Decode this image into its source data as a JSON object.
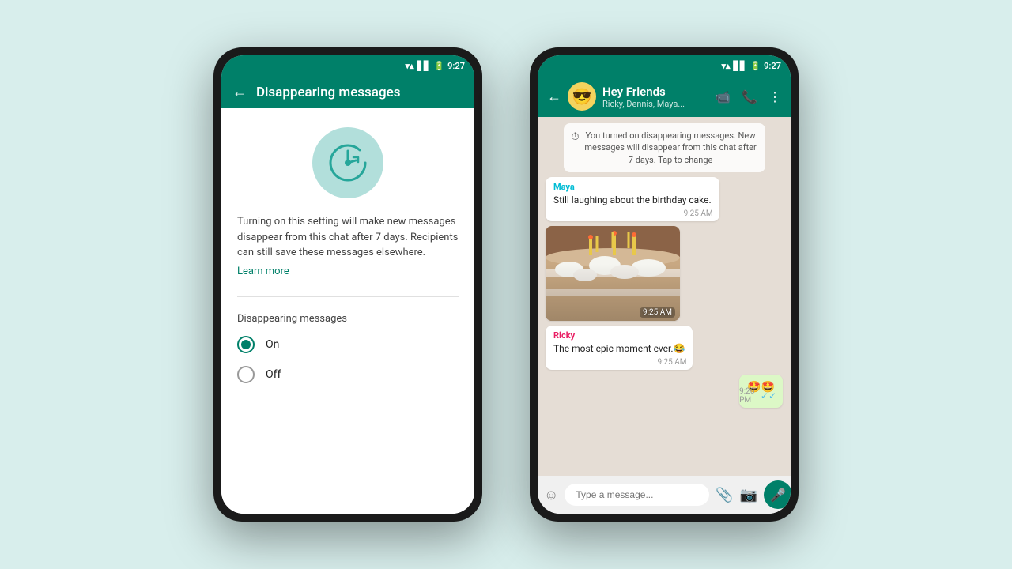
{
  "background": "#d8eeec",
  "phone1": {
    "status_bar": {
      "time": "9:27"
    },
    "header": {
      "title": "Disappearing messages",
      "back_label": "←"
    },
    "description": "Turning on this setting will make new messages disappear from this chat after 7 days. Recipients can still save these messages elsewhere.",
    "learn_more": "Learn more",
    "section_label": "Disappearing messages",
    "options": [
      {
        "id": "on",
        "label": "On",
        "selected": true
      },
      {
        "id": "off",
        "label": "Off",
        "selected": false
      }
    ]
  },
  "phone2": {
    "status_bar": {
      "time": "9:27"
    },
    "header": {
      "group_name": "Hey Friends",
      "members": "Ricky, Dennis, Maya...",
      "emoji": "😎"
    },
    "system_message": "You turned on disappearing messages. New messages will disappear from this chat after 7 days. Tap to change",
    "messages": [
      {
        "type": "incoming",
        "sender": "Maya",
        "sender_color": "#00bcd4",
        "text": "Still laughing about the birthday cake.",
        "time": "9:25 AM"
      },
      {
        "type": "image",
        "sender": "Maya",
        "time": "9:25 AM"
      },
      {
        "type": "incoming",
        "sender": "Ricky",
        "sender_color": "#e91e63",
        "text": "The most epic moment ever.😂",
        "time": "9:25 AM"
      },
      {
        "type": "outgoing",
        "text": "🤩🤩",
        "time": "9:26 PM",
        "read": true
      }
    ],
    "input_placeholder": "Type a message..."
  }
}
